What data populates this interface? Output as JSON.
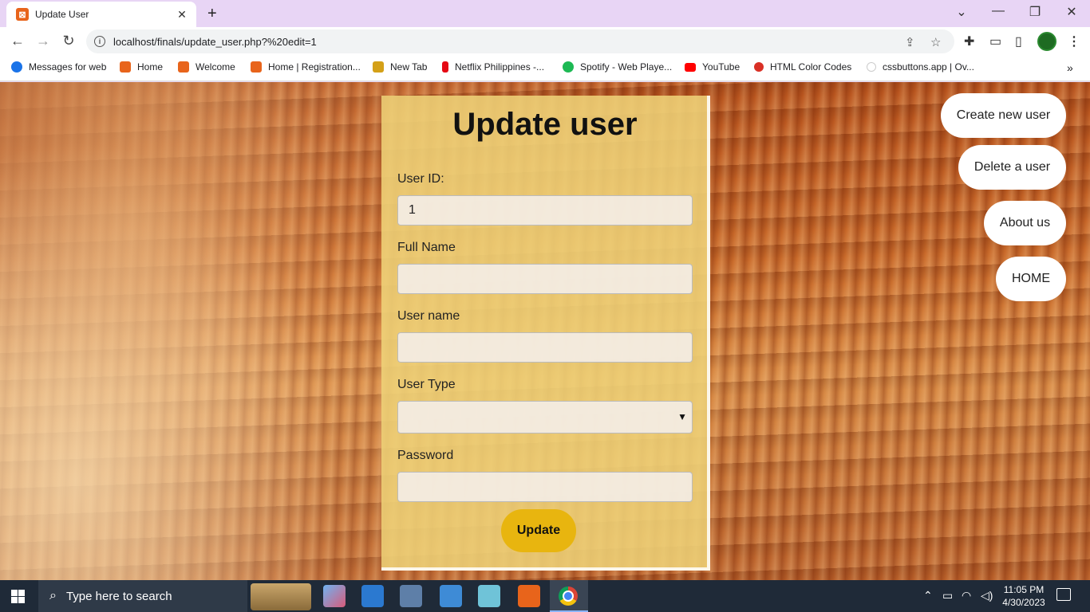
{
  "browser": {
    "tab_title": "Update User",
    "tab_favicon": "xampp-icon",
    "new_tab": "+",
    "url": "localhost/finals/update_user.php?%20edit=1",
    "window_controls": {
      "collapse": "⌄",
      "minimize": "—",
      "restore": "❐",
      "close": "✕"
    },
    "nav": {
      "back": "←",
      "forward": "→",
      "reload": "↻"
    },
    "toolbar_icons": {
      "share": "⇪",
      "star": "☆",
      "extensions": "✚",
      "cast": "▭",
      "sidepanel": "▯"
    },
    "bookmarks": [
      {
        "label": "Messages for web",
        "color": "#1a73e8"
      },
      {
        "label": "Home",
        "color": "#e8641b"
      },
      {
        "label": "Welcome",
        "color": "#e8641b"
      },
      {
        "label": "Home | Registration...",
        "color": "#e8641b"
      },
      {
        "label": "New Tab",
        "color": "#d4a017"
      },
      {
        "label": "Netflix Philippines -...",
        "color": "#e50914"
      },
      {
        "label": "Spotify - Web Playe...",
        "color": "#1db954"
      },
      {
        "label": "YouTube",
        "color": "#ff0000"
      },
      {
        "label": "HTML Color Codes",
        "color": "#d93025"
      },
      {
        "label": "cssbuttons.app | Ov...",
        "color": "#cccccc"
      }
    ],
    "bookmarks_overflow": "»"
  },
  "form": {
    "title": "Update user",
    "user_id_label": "User ID:",
    "user_id_value": "1",
    "full_name_label": "Full Name",
    "full_name_value": "",
    "user_name_label": "User name",
    "user_name_value": "",
    "user_type_label": "User Type",
    "user_type_value": "",
    "password_label": "Password",
    "password_value": "",
    "submit_label": "Update"
  },
  "side_nav": {
    "create": "Create new user",
    "delete": "Delete a user",
    "about": "About us",
    "home": "HOME"
  },
  "taskbar": {
    "search_placeholder": "Type here to search",
    "time": "11:05 PM",
    "date": "4/30/2023"
  }
}
